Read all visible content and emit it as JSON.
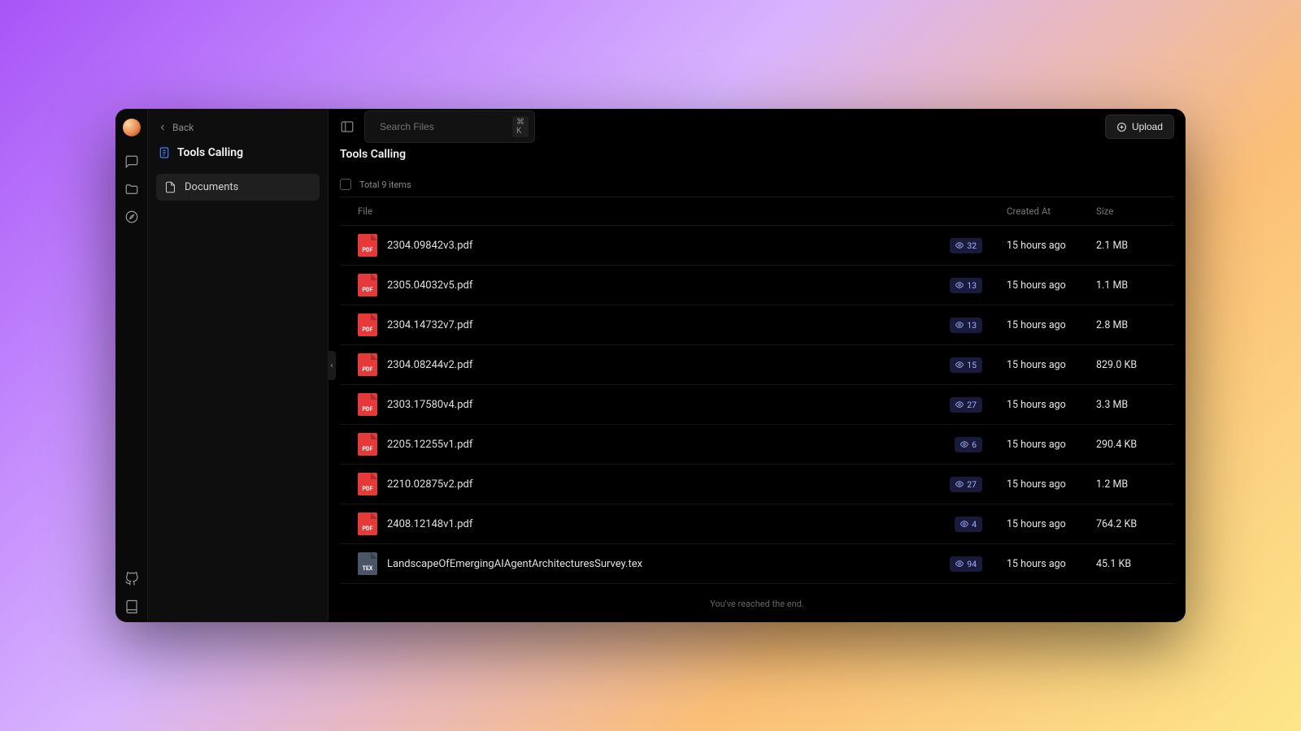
{
  "back_label": "Back",
  "workspace_title": "Tools Calling",
  "sidebar": {
    "items": [
      {
        "label": "Documents"
      }
    ]
  },
  "search": {
    "placeholder": "Search Files",
    "kbd": "⌘ K"
  },
  "upload_label": "Upload",
  "page_title": "Tools Calling",
  "total_label": "Total 9 items",
  "columns": {
    "file": "File",
    "created": "Created At",
    "size": "Size"
  },
  "files": [
    {
      "name": "2304.09842v3.pdf",
      "type": "pdf",
      "badge": "32",
      "created": "15 hours ago",
      "size": "2.1 MB"
    },
    {
      "name": "2305.04032v5.pdf",
      "type": "pdf",
      "badge": "13",
      "created": "15 hours ago",
      "size": "1.1 MB"
    },
    {
      "name": "2304.14732v7.pdf",
      "type": "pdf",
      "badge": "13",
      "created": "15 hours ago",
      "size": "2.8 MB"
    },
    {
      "name": "2304.08244v2.pdf",
      "type": "pdf",
      "badge": "15",
      "created": "15 hours ago",
      "size": "829.0 KB"
    },
    {
      "name": "2303.17580v4.pdf",
      "type": "pdf",
      "badge": "27",
      "created": "15 hours ago",
      "size": "3.3 MB"
    },
    {
      "name": "2205.12255v1.pdf",
      "type": "pdf",
      "badge": "6",
      "created": "15 hours ago",
      "size": "290.4 KB"
    },
    {
      "name": "2210.02875v2.pdf",
      "type": "pdf",
      "badge": "27",
      "created": "15 hours ago",
      "size": "1.2 MB"
    },
    {
      "name": "2408.12148v1.pdf",
      "type": "pdf",
      "badge": "4",
      "created": "15 hours ago",
      "size": "764.2 KB"
    },
    {
      "name": "LandscapeOfEmergingAIAgentArchitecturesSurvey.tex",
      "type": "tex",
      "badge": "94",
      "created": "15 hours ago",
      "size": "45.1 KB"
    }
  ],
  "end_text": "You've reached the end.",
  "icon_labels": {
    "pdf": "PDF",
    "tex": "TEX"
  }
}
